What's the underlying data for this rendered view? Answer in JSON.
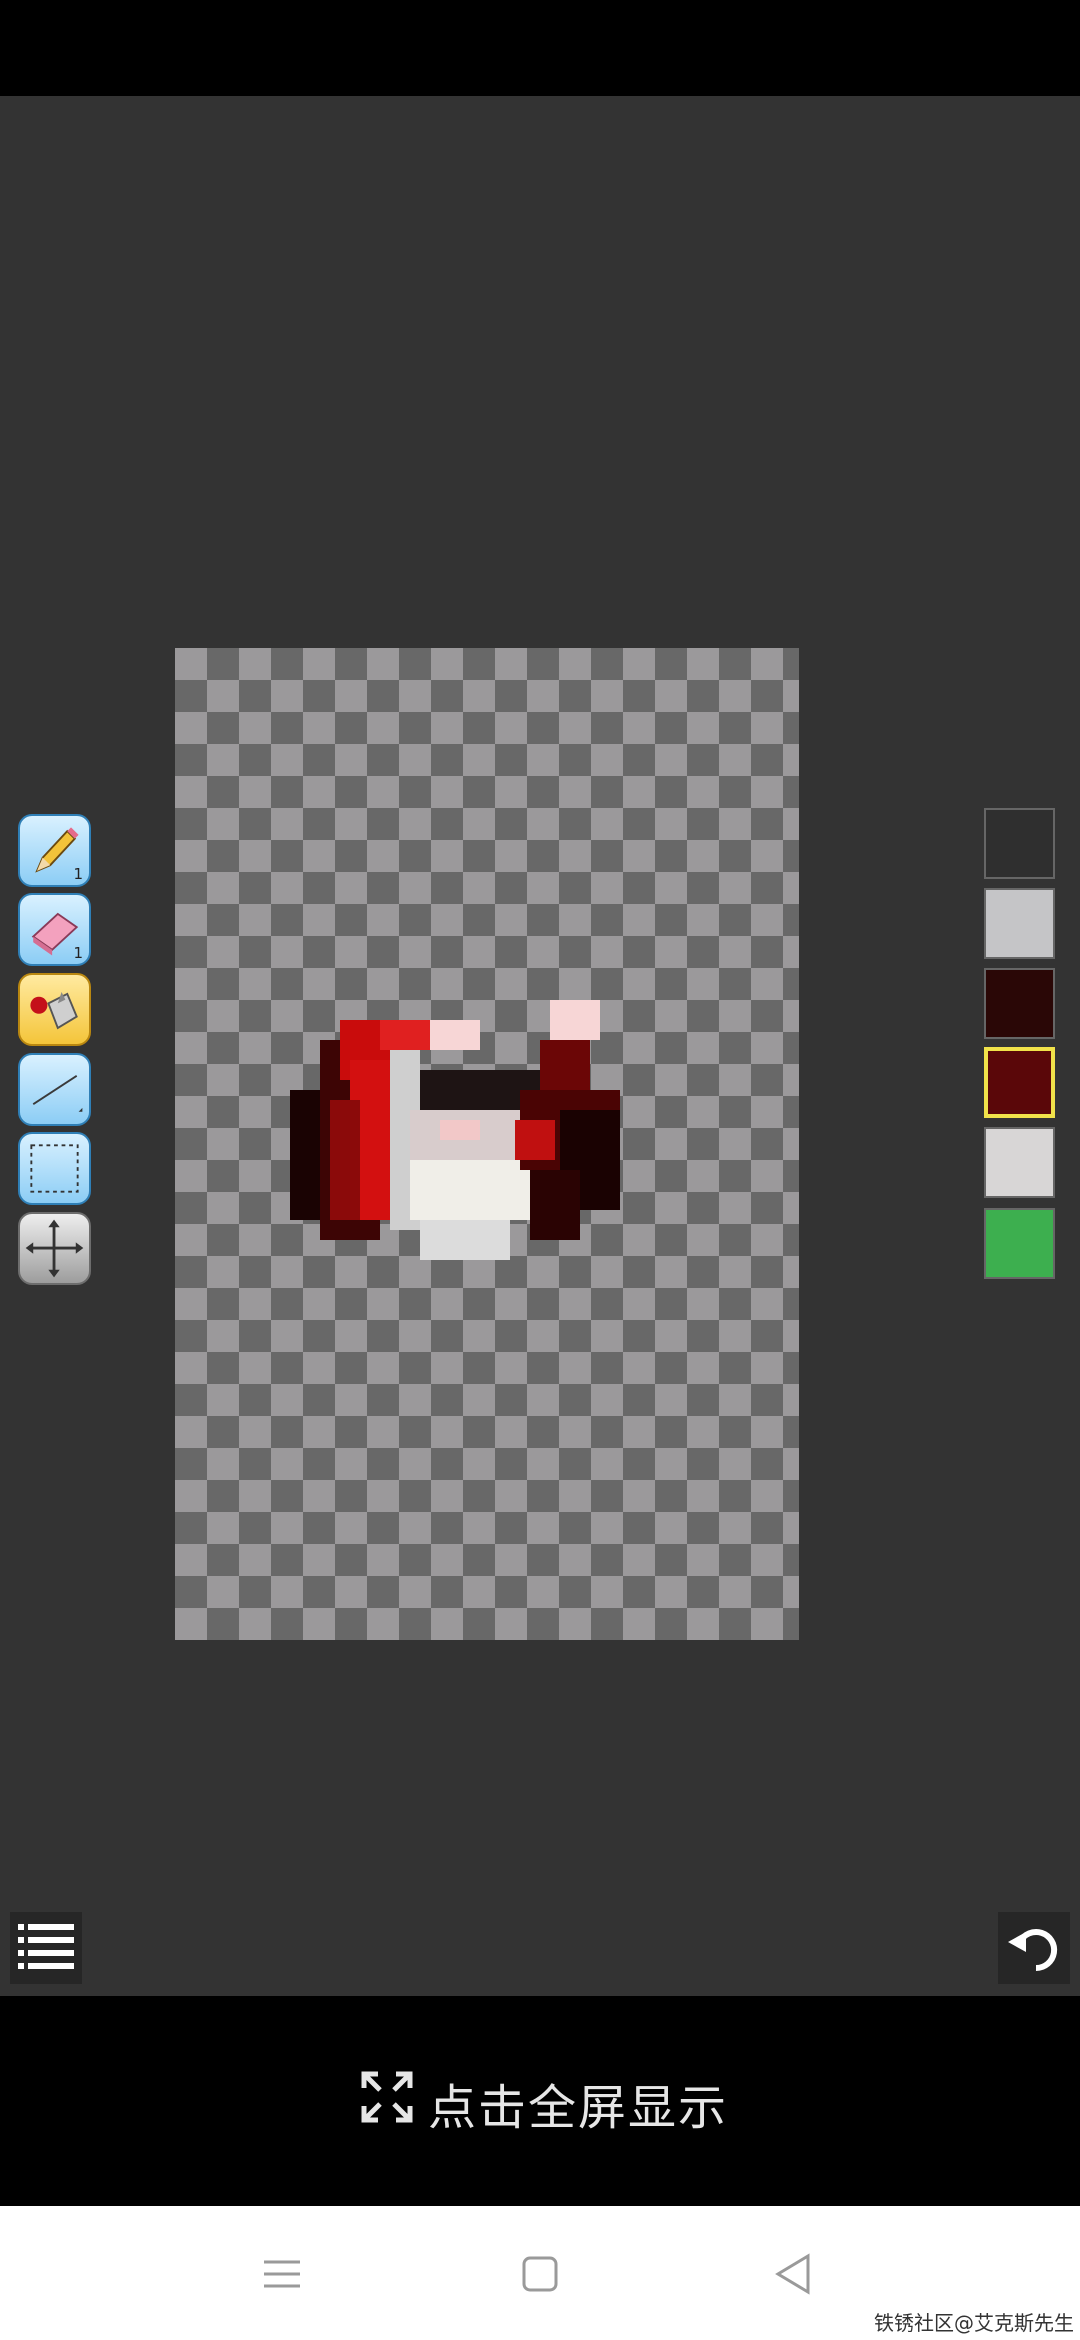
{
  "toolbar": {
    "tools": [
      {
        "name": "pencil",
        "badge": "1"
      },
      {
        "name": "eraser",
        "badge": "1"
      },
      {
        "name": "fill-bucket",
        "badge": ""
      },
      {
        "name": "line",
        "badge": ""
      },
      {
        "name": "rect-select",
        "badge": ""
      },
      {
        "name": "move",
        "badge": ""
      }
    ],
    "active_tool": "fill-bucket"
  },
  "palette": {
    "colors": [
      "#2f2f2f",
      "#c5c5c7",
      "#2a0706",
      "#5a0709",
      "#d8d6d6",
      "#3daf4f"
    ],
    "selected_index": 3
  },
  "fullscreen": {
    "label": "点击全屏显示",
    "icon": "expand-icon"
  },
  "bottom_controls": {
    "menu_icon": "list-icon",
    "undo_icon": "undo-icon"
  },
  "system_nav": {
    "icons": [
      "menu-icon",
      "home-icon",
      "back-icon"
    ]
  },
  "watermark": "铁锈社区@艾克斯先生"
}
